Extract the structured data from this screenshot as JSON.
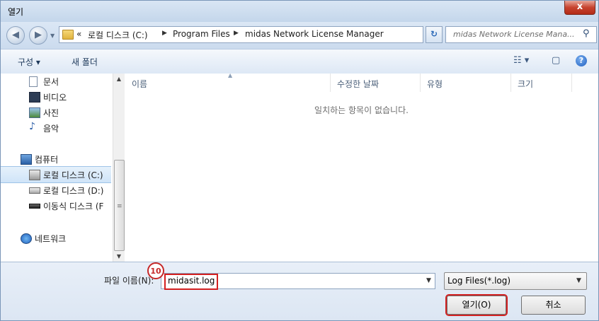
{
  "window": {
    "title": "열기",
    "close_label": "x"
  },
  "nav": {
    "back_glyph": "◀",
    "forward_glyph": "▶",
    "breadcrumb": [
      "«",
      "로컬 디스크 (C:)",
      "Program Files",
      "midas Network License Manager"
    ],
    "refresh_glyph": "↻",
    "search_placeholder": "midas Network License Mana...",
    "search_glyph": "⚲"
  },
  "toolbar": {
    "organize_label": "구성 ▾",
    "new_folder_label": "새 폴더",
    "views_glyph": "☷ ▾",
    "preview_glyph": "▢",
    "help_glyph": "?"
  },
  "navpane": {
    "items": [
      {
        "label": "문서",
        "icon": "document-icon"
      },
      {
        "label": "비디오",
        "icon": "video-icon"
      },
      {
        "label": "사진",
        "icon": "picture-icon"
      },
      {
        "label": "음악",
        "icon": "music-icon"
      },
      {
        "label": "컴퓨터",
        "icon": "computer-icon"
      },
      {
        "label": "로컬 디스크 (C:)",
        "icon": "drive-icon"
      },
      {
        "label": "로컬 디스크 (D:)",
        "icon": "drive-icon"
      },
      {
        "label": "이동식 디스크 (F",
        "icon": "removable-drive-icon"
      },
      {
        "label": "네트워크",
        "icon": "network-icon"
      }
    ],
    "selected_index": 5
  },
  "filelist": {
    "columns": [
      "이름",
      "수정한 날짜",
      "유형",
      "크기"
    ],
    "empty_message": "일치하는 항목이 없습니다."
  },
  "bottom": {
    "filename_label": "파일 이름(N):",
    "filename_value": "midasit.log",
    "filetype_value": "Log Files(*.log)",
    "open_label": "열기(O)",
    "cancel_label": "취소",
    "annotation_badge": "10"
  },
  "colors": {
    "highlight_red": "#d32020",
    "accent_blue": "#1f5fbf"
  }
}
